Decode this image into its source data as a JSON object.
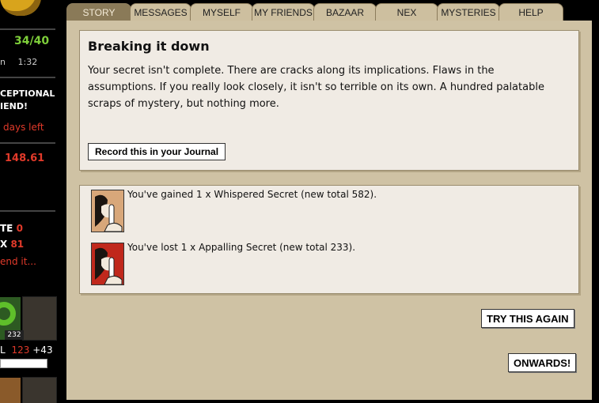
{
  "sidebar": {
    "stat_fraction": "34/40",
    "timer_label": "n",
    "timer": "1:32",
    "exceptional_line1": "CEPTIONAL",
    "exceptional_line2": "IEND!",
    "days_left": "days left",
    "money": "148.61",
    "stat_te_label": "TE",
    "stat_te_value": "0",
    "stat_x_label": "X",
    "stat_x_value": "81",
    "spend_link": "end it...",
    "avatar_badge": "232",
    "stat_l_label": "L",
    "stat_l_value": "123",
    "stat_l_bonus": "+43"
  },
  "tabs": [
    {
      "label": "STORY",
      "active": true
    },
    {
      "label": "MESSAGES"
    },
    {
      "label": "MYSELF"
    },
    {
      "label": "MY FRIENDS"
    },
    {
      "label": "BAZAAR"
    },
    {
      "label": "NEX"
    },
    {
      "label": "MYSTERIES"
    },
    {
      "label": "HELP"
    }
  ],
  "story": {
    "title": "Breaking it down",
    "body": "Your secret isn't complete. There are cracks along its implications. Flaws in the assumptions. If you really look closely, it isn't so terrible on its own. A hundred palatable scraps of mystery, but nothing more.",
    "journal_button": "Record this in your Journal"
  },
  "results": [
    {
      "icon": "whispered-secret-icon",
      "text": "You've gained 1 x Whispered Secret (new total 582)."
    },
    {
      "icon": "appalling-secret-icon",
      "text": "You've lost 1 x Appalling Secret (new total 233)."
    }
  ],
  "actions": {
    "try_again": "TRY THIS AGAIN",
    "onwards": "ONWARDS!"
  },
  "colors": {
    "accent_green": "#7ecf3a",
    "accent_red": "#e23a2a",
    "panel_bg": "#cfc2a4",
    "active_tab": "#8a7a58"
  }
}
